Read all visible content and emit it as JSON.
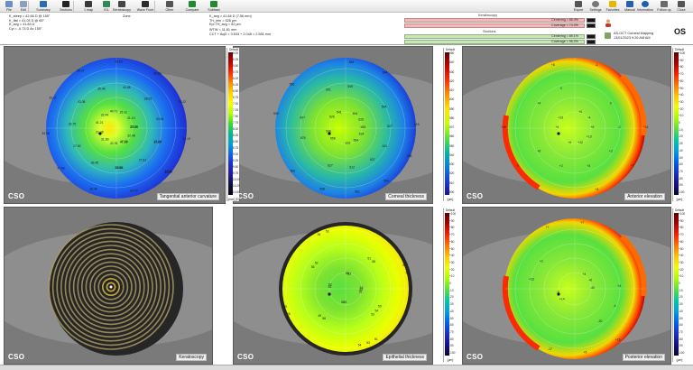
{
  "toolbar": {
    "left_items": [
      {
        "label": "File",
        "icon": "file-icon",
        "color": "#6b8fc4"
      },
      {
        "label": "Edit",
        "icon": "edit-icon",
        "color": "#8aa0bf"
      },
      {
        "label": "Summary",
        "icon": "summary-icon",
        "color": "#2c6db0"
      },
      {
        "label": "Sections",
        "icon": "sections-icon",
        "color": "#222222"
      },
      {
        "label": "1 map",
        "icon": "single-map-icon",
        "color": "#3a3a3a"
      },
      {
        "label": "IOL",
        "icon": "iol-icon",
        "color": "#2e8b57"
      },
      {
        "label": "Keratoscopy",
        "icon": "keratoscopy-icon",
        "color": "#444444"
      },
      {
        "label": "Wave Front",
        "icon": "wavefront-icon",
        "color": "#2a2a2a"
      },
      {
        "label": "Other",
        "icon": "other-icon",
        "color": "#555555"
      },
      {
        "label": "Compare",
        "icon": "compare-icon",
        "color": "#1f8c2f"
      },
      {
        "label": "Subtract",
        "icon": "subtract-icon",
        "color": "#1f8c2f"
      }
    ],
    "right_items": [
      {
        "label": "Export",
        "icon": "export-icon",
        "color": "#555555"
      },
      {
        "label": "Settings",
        "icon": "settings-icon",
        "color": "#777777"
      },
      {
        "label": "Favorites",
        "icon": "favorites-icon",
        "color": "#e6b800"
      },
      {
        "label": "Manual",
        "icon": "manual-icon",
        "color": "#2a5fb0"
      },
      {
        "label": "Information",
        "icon": "information-icon",
        "color": "#1f5fb0"
      },
      {
        "label": "Follow up",
        "icon": "follow-up-icon",
        "color": "#6a6a6a"
      },
      {
        "label": "Close",
        "icon": "close-icon",
        "color": "#555555"
      }
    ]
  },
  "info": {
    "col1": [
      "K_steep = 42.66 D @ 155°",
      "K_flat = 41.03 D @ 65°",
      "K_avg = 41.83 D",
      "Cyl = -0.73 D Ax 155°"
    ],
    "zone_label": "Zone",
    "col2": [
      "K_avg = 41.84 D (7.56 mm)",
      "TH_min = 526 μm",
      "Epi TH_avg = 52 μm"
    ],
    "col3": [
      "WTW = 11.81 mm",
      "CCT + AqD = 0.533 + 2.046 = 2.581 mm"
    ],
    "keratoscopy_title": "Keratoscopy",
    "keratoscopy_bars": [
      "Centering = 85.4%",
      "Coverage = 74.9%"
    ],
    "sections_title": "Sections",
    "sections_bars": [
      "Centering = 89.1%",
      "Coverage = 96.2%"
    ],
    "device_name": "AS-OCT Corneal Mapping",
    "exam_date": "13/01/2023 9:26 AM AM",
    "eye": "OS"
  },
  "panels": [
    {
      "label": "Tangential anterior curvature",
      "scale_head": "Default",
      "scale_unit": "[mm] [D]",
      "kind": "curvature"
    },
    {
      "label": "Corneal thickness",
      "scale_head": "Default",
      "scale_unit": "[μm]",
      "kind": "thickness"
    },
    {
      "label": "Anterior elevation",
      "scale_head": "Default",
      "scale_unit": "[μm]",
      "kind": "elevation"
    },
    {
      "label": "Keratoscopy",
      "scale_head": "",
      "scale_unit": "",
      "kind": "keratoscopy"
    },
    {
      "label": "Epithelial thickness",
      "scale_head": "Default",
      "scale_unit": "[μm]",
      "kind": "epithelium"
    },
    {
      "label": "Posterior elevation",
      "scale_head": "Default",
      "scale_unit": "[μm]",
      "kind": "elevation"
    }
  ],
  "brand": "CSO",
  "scales": {
    "curvature": [
      "5.00",
      "5.25",
      "5.50",
      "5.75",
      "6.00",
      "6.25",
      "6.50",
      "6.75",
      "7.00",
      "7.25",
      "7.50",
      "7.75",
      "8.00",
      "8.25",
      "8.50",
      "8.75",
      "9.00",
      "9.25",
      "9.50",
      "9.75",
      "10.00",
      "10.25",
      "10.50"
    ],
    "thickness": [
      "650",
      "640",
      "630",
      "620",
      "610",
      "600",
      "590",
      "580",
      "570",
      "560",
      "550",
      "540",
      "530",
      "520",
      "510",
      "500"
    ],
    "elevation": [
      "+100",
      "+90",
      "+80",
      "+70",
      "+60",
      "+50",
      "+40",
      "+30",
      "+20",
      "+10",
      "0",
      "-10",
      "-20",
      "-30",
      "-40",
      "-50",
      "-60",
      "-70",
      "-80",
      "-90",
      "-100"
    ],
    "epithelium": [
      "+100",
      "+90",
      "+80",
      "+70",
      "+60",
      "+50",
      "+40",
      "+30",
      "+20",
      "+10",
      "0",
      "-10",
      "-20",
      "-30",
      "-40",
      "-50",
      "-60",
      "-70",
      "-80",
      "-90",
      "-100"
    ]
  },
  "map_values": {
    "curvature": [
      "22.66",
      "37.57",
      "40.24",
      "41.33",
      "32.90",
      "35.46",
      "31.83",
      "27.82",
      "34.58",
      "41.21",
      "42.08",
      "35.37",
      "40.71",
      "40.48",
      "28.49",
      "31.13",
      "43.04",
      "43.19",
      "32.48",
      "27.61",
      "34.70",
      "41.91",
      "39.45",
      "37.80",
      "21.48",
      "33.75",
      "33.21",
      "32.44",
      "35.46",
      "26.82",
      "26.11",
      "28.63",
      "25.22",
      "23.24",
      "21.95",
      "19.93",
      "17.03",
      "18.46"
    ],
    "thickness": [
      "653",
      "621",
      "584",
      "579",
      "627",
      "562",
      "540",
      "607",
      "556",
      "541",
      "549",
      "544",
      "629",
      "527",
      "536",
      "564",
      "612",
      "568",
      "558",
      "576",
      "599",
      "626",
      "601",
      "562",
      "604",
      "594",
      "615",
      "624",
      "637",
      "561"
    ],
    "elevation": [
      "+6",
      "+3",
      "+3",
      "+4",
      "+8",
      "+16",
      "+13",
      "0",
      "-1",
      "-4",
      "-2",
      "+7",
      "+12",
      "+2",
      "-3",
      "+4",
      "+4",
      "+8",
      "+4",
      "0",
      "+11",
      "+13",
      "+3"
    ],
    "epithelium": [
      "53",
      "50",
      "51",
      "53",
      "56",
      "55",
      "52",
      "55",
      "54",
      "50",
      "51",
      "52",
      "55",
      "54",
      "53",
      "52",
      "49",
      "55",
      "52",
      "52",
      "53",
      "53",
      "58",
      "59",
      "51",
      "52",
      "54"
    ],
    "posterior": [
      "-40",
      "-20",
      "-17",
      "-3",
      "+2",
      "+7",
      "+6",
      "-4",
      "+5",
      "+14",
      "+23",
      "+7",
      "+3",
      "+4",
      "+15"
    ]
  }
}
